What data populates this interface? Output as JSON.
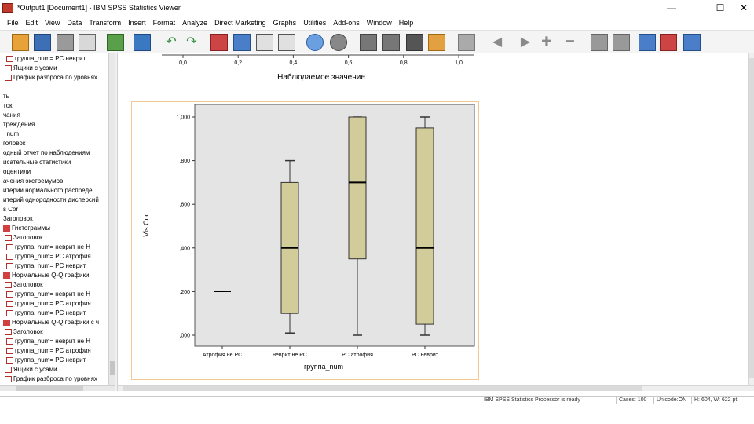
{
  "window": {
    "title": "*Output1 [Document1] - IBM SPSS Statistics Viewer",
    "minimize": "—",
    "maximize": "☐",
    "close": "✕"
  },
  "menu": [
    "File",
    "Edit",
    "View",
    "Data",
    "Transform",
    "Insert",
    "Format",
    "Analyze",
    "Direct Marketing",
    "Graphs",
    "Utilities",
    "Add-ons",
    "Window",
    "Help"
  ],
  "toolbar_icons": [
    "open-icon",
    "save-icon",
    "print-icon",
    "print-preview-icon",
    "export-icon",
    "recall-dialog-icon",
    "undo-icon",
    "redo-icon",
    "goto-data-icon",
    "goto-case-icon",
    "goto-variable-icon",
    "variables-icon",
    "designated-window-icon",
    "select-last-output-icon",
    "promote-icon",
    "demote-icon",
    "expand-icon",
    "collapse-icon",
    "show-icon",
    "hide-icon",
    "insert-heading-icon",
    "insert-title-icon",
    "insert-text-icon",
    "back-icon",
    "forward-icon",
    "add-icon",
    "remove-icon",
    "page-setup-icon",
    "outline-icon"
  ],
  "tree": [
    {
      "text": "группа_num= РС неврит",
      "icon": "chart"
    },
    {
      "text": "Ящики с усами",
      "icon": "doc"
    },
    {
      "text": "График разброса по уровнях",
      "icon": "doc"
    },
    {
      "text": "",
      "icon": ""
    },
    {
      "text": "ть",
      "icon": ""
    },
    {
      "text": "ток",
      "icon": ""
    },
    {
      "text": "чания",
      "icon": ""
    },
    {
      "text": "треждения",
      "icon": ""
    },
    {
      "text": "_num",
      "icon": ""
    },
    {
      "text": "головок",
      "icon": ""
    },
    {
      "text": "одный отчет по наблюдениям",
      "icon": ""
    },
    {
      "text": "исательные статистики",
      "icon": ""
    },
    {
      "text": "оцентили",
      "icon": ""
    },
    {
      "text": "ачения экстремумов",
      "icon": ""
    },
    {
      "text": "итерии нормального распреде",
      "icon": ""
    },
    {
      "text": "итерий однородности дисперсий",
      "icon": ""
    },
    {
      "text": "s Cor",
      "icon": ""
    },
    {
      "text": "Заголовок",
      "icon": ""
    },
    {
      "text": "Гистограммы",
      "icon": "book"
    },
    {
      "text": "Заголовок",
      "icon": "doc"
    },
    {
      "text": "группа_num= неврит не Н",
      "icon": "chart"
    },
    {
      "text": "группа_num= РС атрофия",
      "icon": "chart"
    },
    {
      "text": "группа_num= РС неврит",
      "icon": "chart"
    },
    {
      "text": "Нормальные Q-Q графики",
      "icon": "book"
    },
    {
      "text": "Заголовок",
      "icon": "doc"
    },
    {
      "text": "группа_num= неврит не Н",
      "icon": "chart"
    },
    {
      "text": "группа_num= РС атрофия",
      "icon": "chart"
    },
    {
      "text": "группа_num= РС неврит",
      "icon": "chart"
    },
    {
      "text": "Нормальные Q-Q графики с ч",
      "icon": "book"
    },
    {
      "text": "Заголовок",
      "icon": "doc"
    },
    {
      "text": "группа_num= неврит не Н",
      "icon": "chart"
    },
    {
      "text": "группа_num= РС атрофия",
      "icon": "chart"
    },
    {
      "text": "группа_num= РС неврит",
      "icon": "chart"
    },
    {
      "text": "Ящики с усами",
      "icon": "doc"
    },
    {
      "text": "График разброса по уровнях",
      "icon": "doc"
    }
  ],
  "top_chart": {
    "ticks": [
      "0,0",
      "0,2",
      "0,4",
      "0,6",
      "0,8",
      "1,0"
    ],
    "xlabel": "Наблюдаемое значение"
  },
  "status": {
    "processor": "IBM SPSS Statistics Processor is ready",
    "cases": "Cases: 100",
    "unicode": "Unicode:ON",
    "size": "H: 604, W: 622 pt"
  },
  "colors": {
    "plot_bg": "#e4e4e4",
    "box_fill": "#d2cb9a",
    "box_stroke": "#333333",
    "selection": "#f0c890"
  },
  "chart_data": {
    "type": "boxplot",
    "title": "",
    "xlabel": "группа_num",
    "ylabel": "Vis Cor",
    "ylim": [
      0,
      1
    ],
    "yticks": [
      0,
      0.2,
      0.4,
      0.6,
      0.8,
      1.0
    ],
    "ytick_labels": [
      ",000",
      ",200",
      ",400",
      ",600",
      ",800",
      "1,000"
    ],
    "categories": [
      "Атрофия не РС",
      "неврит не РС",
      "РС атрофия",
      "РС неврит"
    ],
    "boxes": [
      {
        "category": "Атрофия не РС",
        "min": 0.2,
        "q1": 0.2,
        "median": 0.2,
        "q3": 0.2,
        "max": 0.2
      },
      {
        "category": "неврит не РС",
        "min": 0.01,
        "q1": 0.1,
        "median": 0.4,
        "q3": 0.7,
        "max": 0.8
      },
      {
        "category": "РС атрофия",
        "min": 0.0,
        "q1": 0.35,
        "median": 0.7,
        "q3": 1.0,
        "max": 1.0
      },
      {
        "category": "РС неврит",
        "min": 0.0,
        "q1": 0.05,
        "median": 0.4,
        "q3": 0.95,
        "max": 1.0
      }
    ]
  }
}
